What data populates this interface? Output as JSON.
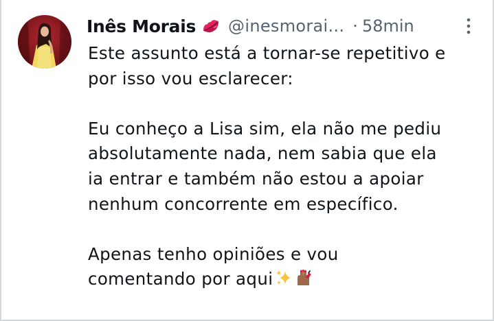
{
  "post": {
    "author": {
      "display_name": "Inês Morais",
      "verified_emoji": "lips-emoji",
      "handle": "@inesmorai...",
      "separator": "·",
      "time": "58min"
    },
    "lines": [
      "Este assunto está a tornar-se repetitivo e",
      "por isso vou esclarecer:",
      "",
      "Eu conheço a Lisa sim, ela não me pediu",
      "absolutamente nada, nem sabia que ela",
      "ia entrar e também não estou a apoiar",
      "nenhum concorrente em específico.",
      "",
      "Apenas tenho opiniões e vou",
      "comentando por aqui"
    ],
    "trailing_emojis": [
      "sparkles-emoji",
      "nail-polish-emoji"
    ]
  },
  "colors": {
    "text": "#0f1419",
    "secondary": "#536471",
    "border": "#cfd9de",
    "lips": "#e0245e"
  }
}
